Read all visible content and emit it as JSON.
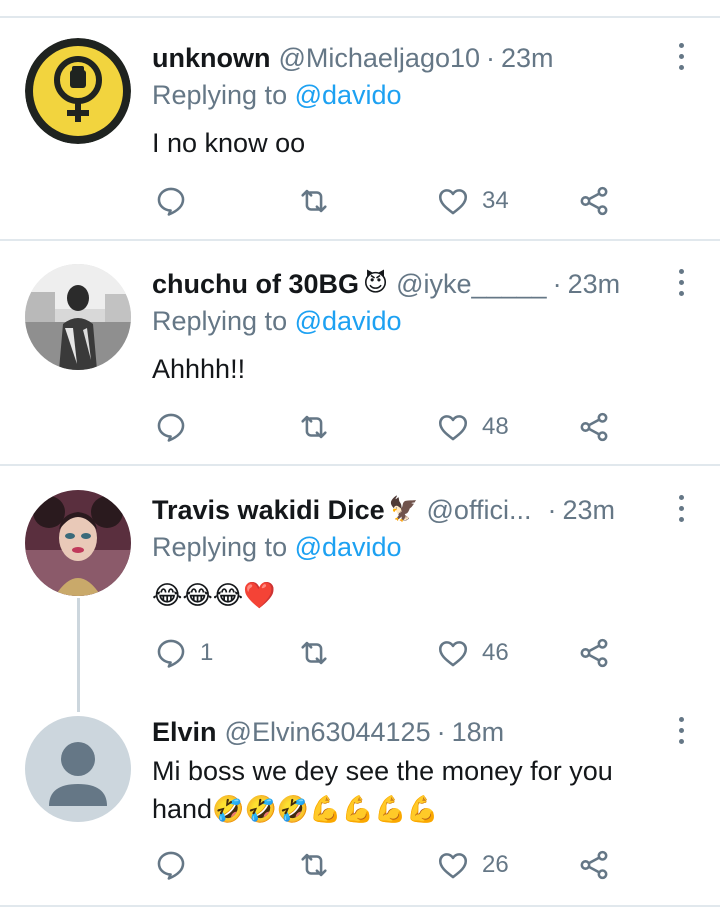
{
  "replying_label": "Replying to ",
  "tweets": [
    {
      "name": "unknown",
      "name_emoji": "",
      "handle": "@Michaeljago10",
      "dot": "·",
      "time": "23m",
      "replying_to": "@davido",
      "text": "I no know oo",
      "text_emojis": "",
      "reply_count": "",
      "like_count": "34",
      "avatar": "yellow-feminist-fist-symbol"
    },
    {
      "name": "chuchu of 30BG",
      "name_emoji": "😈",
      "handle": "@iyke_____",
      "dot": "·",
      "time": "23m",
      "replying_to": "@davido",
      "text": "Ahhhh!!",
      "text_emojis": "",
      "reply_count": "",
      "like_count": "48",
      "avatar": "black-and-white-photo-of-man"
    },
    {
      "name": "Travis wakidi Dice",
      "name_emoji": "🦅",
      "handle": "@offici...",
      "dot": "·",
      "time": "23m",
      "replying_to": "@davido",
      "text": "",
      "text_emojis": "😂😂😂❤️",
      "reply_count": "1",
      "like_count": "46",
      "avatar": "illustrated-woman-portrait"
    },
    {
      "name": "Elvin",
      "name_emoji": "",
      "handle": "@Elvin63044125",
      "dot": "·",
      "time": "18m",
      "replying_to": "",
      "text": "Mi boss we dey see the money for you",
      "text_line2": "hand",
      "text_emojis": "🤣🤣🤣💪💪💪💪",
      "reply_count": "",
      "like_count": "26",
      "avatar": "default-profile-silhouette"
    }
  ],
  "colors": {
    "link": "#1da1f2",
    "secondary": "#657786",
    "separator": "#e1e8ed",
    "thread_line": "#ccd6dd"
  }
}
